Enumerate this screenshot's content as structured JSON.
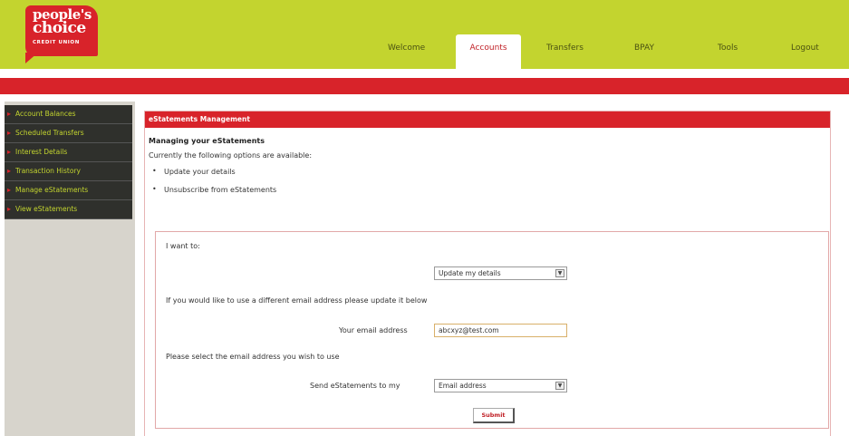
{
  "logo": {
    "line1": "people's",
    "line2": "choice",
    "line3": "CREDIT UNION"
  },
  "nav": {
    "tabs": [
      {
        "label": "Welcome",
        "active": false
      },
      {
        "label": "Accounts",
        "active": true
      },
      {
        "label": "Transfers",
        "active": false
      },
      {
        "label": "BPAY",
        "active": false
      },
      {
        "label": "Tools",
        "active": false
      },
      {
        "label": "Logout",
        "active": false
      }
    ]
  },
  "sidebar": {
    "items": [
      {
        "label": "Account Balances"
      },
      {
        "label": "Scheduled Transfers"
      },
      {
        "label": "Interest Details"
      },
      {
        "label": "Transaction History"
      },
      {
        "label": "Manage eStatements"
      },
      {
        "label": "View eStatements"
      }
    ]
  },
  "panel": {
    "title": "eStatements Management",
    "heading": "Managing your eStatements",
    "intro": "Currently the following options are available:",
    "options": [
      "Update your details",
      "Unsubscribe from eStatements"
    ]
  },
  "form": {
    "want_label": "I want to:",
    "action_select": "Update my details",
    "email_instruction": "If you would like to use a different email address please update it below",
    "email_label": "Your email address",
    "email_value": "abcxyz@test.com",
    "select_instruction": "Please select the email address you wish to use",
    "send_label": "Send eStatements to my",
    "send_select": "Email address",
    "submit_label": "Submit"
  },
  "colors": {
    "brand_green": "#c3d42f",
    "brand_red": "#d8232a",
    "sidebar_dark": "#2f302c"
  }
}
